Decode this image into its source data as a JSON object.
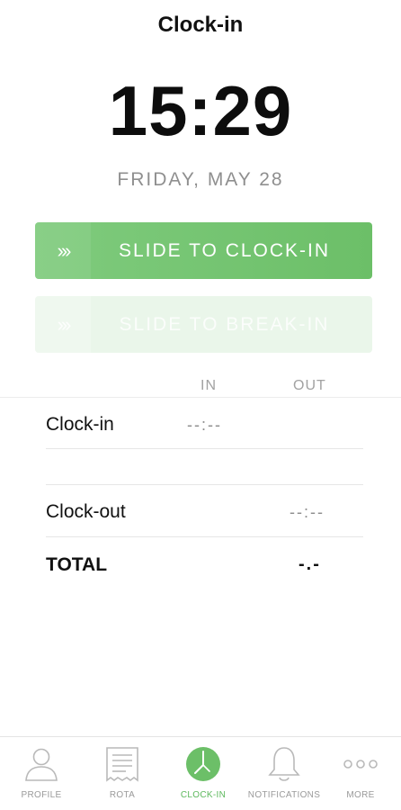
{
  "header": {
    "title": "Clock-in"
  },
  "clock": {
    "time": "15:29",
    "date": "FRIDAY, MAY 28"
  },
  "sliders": {
    "clockin": {
      "label": "SLIDE TO CLOCK-IN",
      "arrows": "›››"
    },
    "breakin": {
      "label": "SLIDE TO BREAK-IN",
      "arrows": "›››"
    }
  },
  "table": {
    "col_in": "IN",
    "col_out": "OUT",
    "rows": [
      {
        "label": "Clock-in",
        "value": "--:--"
      },
      {
        "label": "Clock-out",
        "value": "--:--"
      },
      {
        "label": "TOTAL",
        "value": "-.-"
      }
    ]
  },
  "tabbar": {
    "items": [
      {
        "label": "PROFILE",
        "icon": "profile-icon"
      },
      {
        "label": "ROTA",
        "icon": "rota-icon"
      },
      {
        "label": "CLOCK-IN",
        "icon": "clock-icon",
        "active": true
      },
      {
        "label": "NOTIFICATIONS",
        "icon": "bell-icon"
      },
      {
        "label": "MORE",
        "icon": "more-icon"
      }
    ]
  },
  "colors": {
    "accent": "#6cbf68",
    "accent_light": "#eaf6ea",
    "muted": "#9a9a9a"
  }
}
